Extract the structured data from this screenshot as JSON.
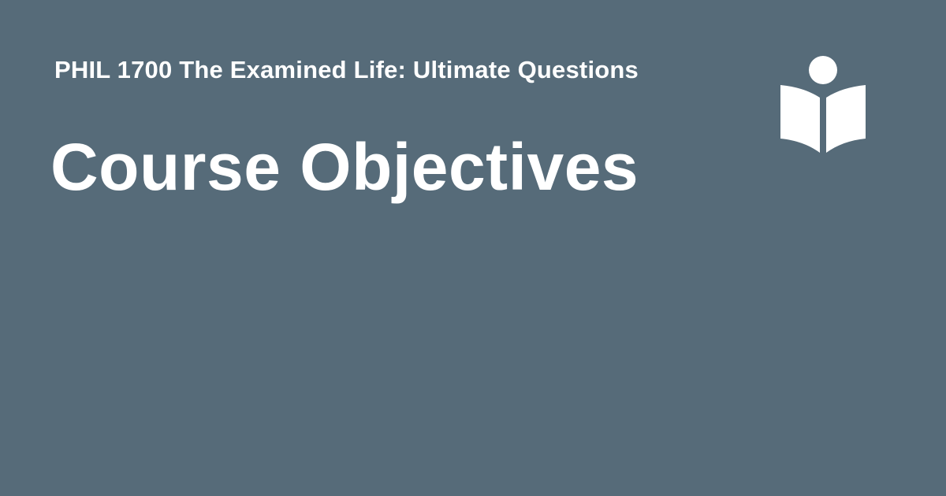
{
  "header": {
    "course_name": "PHIL 1700 The Examined Life: Ultimate Questions",
    "page_title": "Course Objectives"
  },
  "icons": {
    "logo": "reader-book-icon"
  },
  "colors": {
    "background": "#566b79",
    "text": "#ffffff",
    "icon": "#ffffff"
  }
}
